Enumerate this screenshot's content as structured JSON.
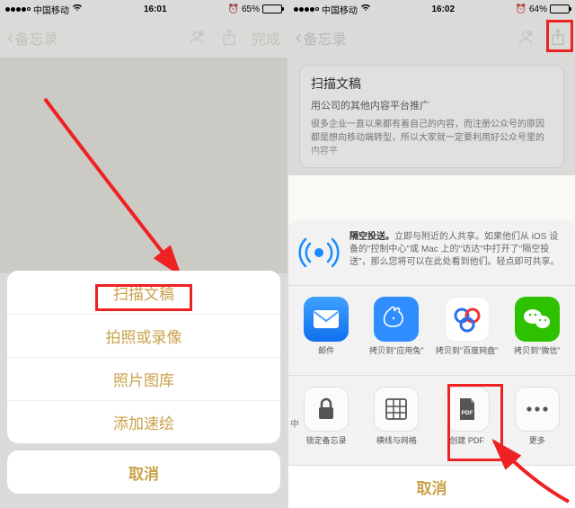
{
  "left": {
    "status": {
      "carrier": "中国移动",
      "time": "16:01",
      "battery": "65%"
    },
    "nav": {
      "back": "备忘录",
      "done": "完成"
    },
    "sheet": {
      "items": [
        "扫描文稿",
        "拍照或录像",
        "照片图库",
        "添加速绘"
      ],
      "cancel": "取消"
    }
  },
  "right": {
    "status": {
      "carrier": "中国移动",
      "time": "16:02",
      "battery": "64%"
    },
    "nav": {
      "back": "备忘录"
    },
    "note": {
      "title": "扫描文稿",
      "sub": "用公司的其他内容平台推广",
      "body": "很多企业一直以来都有着自己的内容，而注册公众号的原因都是想向移动端转型，所以大家就一定要利用好公众号里的内容平"
    },
    "airdrop": {
      "title": "隔空投送。",
      "text": "立即与附近的人共享。如果他们从 iOS 设备的\"控制中心\"或 Mac 上的\"访达\"中打开了\"隔空投送\"，那么您将可以在此处看到他们。轻点即可共享。"
    },
    "apps": [
      {
        "label": "邮件"
      },
      {
        "label": "拷贝到\"应用兔\""
      },
      {
        "label": "拷贝到\"百度网盘\""
      },
      {
        "label": "拷贝到\"微信\""
      }
    ],
    "actions": {
      "lead_char": "中",
      "items": [
        {
          "label": "锁定备忘录"
        },
        {
          "label": "横线与网格"
        },
        {
          "label": "创建 PDF"
        },
        {
          "label": "更多"
        }
      ]
    },
    "cancel": "取消"
  }
}
